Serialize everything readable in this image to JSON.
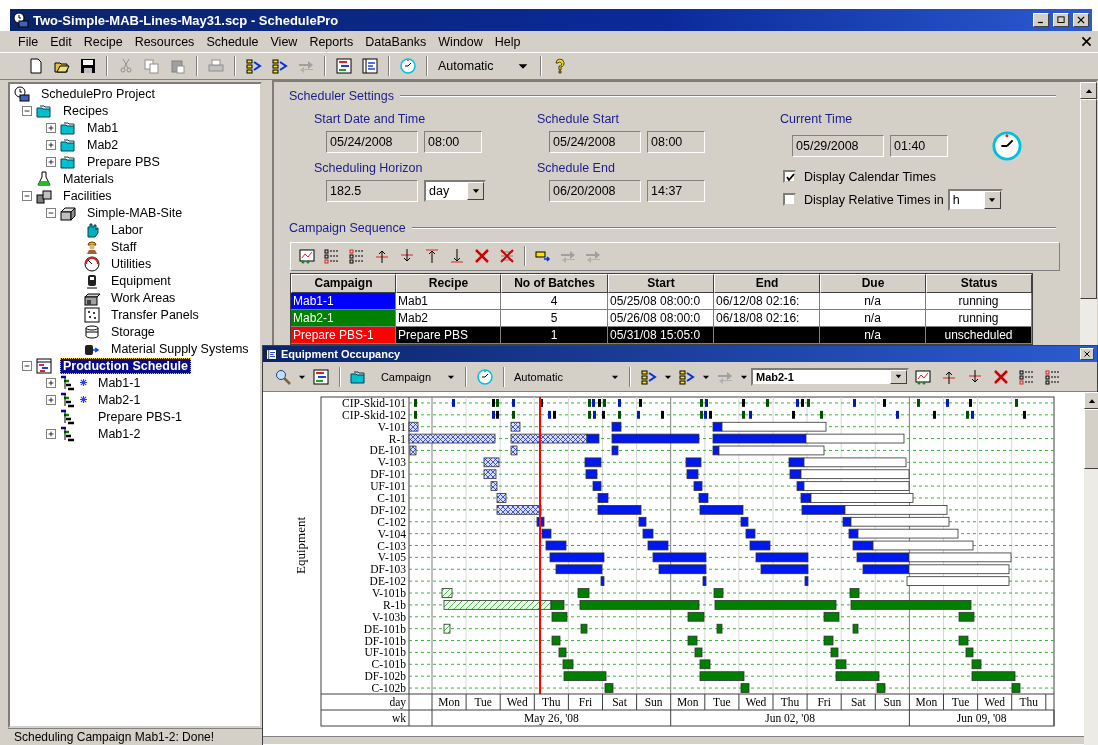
{
  "window": {
    "title": "Two-Simple-MAB-Lines-May31.scp - SchedulePro"
  },
  "menu": [
    "File",
    "Edit",
    "Recipe",
    "Resources",
    "Schedule",
    "View",
    "Reports",
    "DataBanks",
    "Window",
    "Help"
  ],
  "toolbar": {
    "mode": "Automatic"
  },
  "tree": [
    {
      "label": "SchedulePro Project",
      "kind": "project",
      "selected": false,
      "children": [
        {
          "label": "Recipes",
          "kind": "folder",
          "expanded": true,
          "selected": false,
          "children": [
            {
              "label": "Mab1",
              "kind": "folder",
              "expanded": false,
              "selected": false
            },
            {
              "label": "Mab2",
              "kind": "folder",
              "expanded": false,
              "selected": false
            },
            {
              "label": "Prepare PBS",
              "kind": "folder",
              "expanded": false,
              "selected": false
            }
          ]
        },
        {
          "label": "Materials",
          "kind": "flask",
          "selected": false
        },
        {
          "label": "Facilities",
          "kind": "facilities",
          "expanded": true,
          "selected": false,
          "children": [
            {
              "label": "Simple-MAB-Site",
              "kind": "site",
              "expanded": true,
              "selected": false,
              "children": [
                {
                  "label": "Labor",
                  "kind": "labor",
                  "selected": false
                },
                {
                  "label": "Staff",
                  "kind": "staff",
                  "selected": false
                },
                {
                  "label": "Utilities",
                  "kind": "utilities",
                  "selected": false
                },
                {
                  "label": "Equipment",
                  "kind": "equipment",
                  "selected": false
                },
                {
                  "label": "Work Areas",
                  "kind": "workarea",
                  "selected": false
                },
                {
                  "label": "Transfer Panels",
                  "kind": "panel",
                  "selected": false
                },
                {
                  "label": "Storage",
                  "kind": "storage",
                  "selected": false
                },
                {
                  "label": "Material Supply Systems",
                  "kind": "supply",
                  "selected": false
                }
              ]
            }
          ]
        },
        {
          "label": "Production Schedule",
          "kind": "schedule",
          "expanded": true,
          "selected": true,
          "children": [
            {
              "label": "Mab1-1",
              "kind": "campaign",
              "expanded": false,
              "selected": false,
              "modified": true
            },
            {
              "label": "Mab2-1",
              "kind": "campaign",
              "expanded": false,
              "selected": false,
              "modified": true
            },
            {
              "label": "Prepare PBS-1",
              "kind": "campaign",
              "selected": false,
              "modified": false
            },
            {
              "label": "Mab1-2",
              "kind": "campaign",
              "expanded": false,
              "selected": false,
              "modified": false
            }
          ]
        }
      ]
    }
  ],
  "scheduler_settings": {
    "title": "Scheduler Settings",
    "start_date_time": {
      "label": "Start Date and Time",
      "date": "05/24/2008",
      "time": "08:00"
    },
    "schedule_start": {
      "label": "Schedule Start",
      "date": "05/24/2008",
      "time": "08:00"
    },
    "current_time": {
      "label": "Current Time",
      "date": "05/29/2008",
      "time": "01:40"
    },
    "scheduling_horizon": {
      "label": "Scheduling Horizon",
      "value": "182.5",
      "unit": "day"
    },
    "schedule_end": {
      "label": "Schedule End",
      "date": "06/20/2008",
      "time": "14:37"
    },
    "display_calendar_times": {
      "label": "Display Calendar Times",
      "checked": true
    },
    "display_relative_times": {
      "label": "Display Relative Times in",
      "checked": false,
      "unit": "h"
    }
  },
  "campaign_sequence": {
    "title": "Campaign Sequence",
    "columns": [
      "Campaign",
      "Recipe",
      "No of Batches",
      "Start",
      "End",
      "Due",
      "Status"
    ],
    "rows": [
      {
        "campaign": "Mab1-1",
        "color": "#0000ff",
        "recipe": "Mab1",
        "batches": "4",
        "start": "05/25/08 08:00:0",
        "end": "06/12/08 02:16:",
        "due": "n/a",
        "status": "running",
        "selected": false
      },
      {
        "campaign": "Mab2-1",
        "color": "#008000",
        "recipe": "Mab2",
        "batches": "5",
        "start": "05/26/08 08:00:0",
        "end": "06/18/08 02:16:",
        "due": "n/a",
        "status": "running",
        "selected": false
      },
      {
        "campaign": "Prepare PBS-1",
        "color": "#ff0000",
        "recipe": "Prepare PBS",
        "batches": "1",
        "start": "05/31/08 15:05:0",
        "due": "n/a",
        "status": "unscheduled",
        "selected": true
      }
    ]
  },
  "occupancy": {
    "title": "Equipment Occupancy",
    "group_by": "Campaign",
    "mode": "Automatic",
    "campaign": "Mab2-1",
    "gantt": {
      "axis_title": "Equipment",
      "equipment": [
        "CIP-Skid-101",
        "CIP-Skid-102",
        "V-101",
        "R-1",
        "DE-101",
        "V-103",
        "DF-101",
        "UF-101",
        "C-101",
        "DF-102",
        "C-102",
        "V-104",
        "C-103",
        "V-105",
        "DF-103",
        "DE-102",
        "V-101b",
        "R-1b",
        "V-103b",
        "DE-101b",
        "DF-101b",
        "UF-101b",
        "C-101b",
        "DF-102b",
        "C-102b"
      ],
      "day_row_label": "day",
      "week_row_label": "wk",
      "days": [
        "Mon",
        "Tue",
        "Wed",
        "Thu",
        "Fri",
        "Sat",
        "Sun",
        "Mon",
        "Tue",
        "Wed",
        "Thu",
        "Fri",
        "Sat",
        "Sun",
        "Mon",
        "Tue",
        "Wed",
        "Thu"
      ],
      "weeks": [
        "May 26, '08",
        "Jun 02, '08",
        "Jun 09, '08"
      ]
    }
  },
  "status_bar": "Scheduling Campaign Mab1-2: Done!"
}
